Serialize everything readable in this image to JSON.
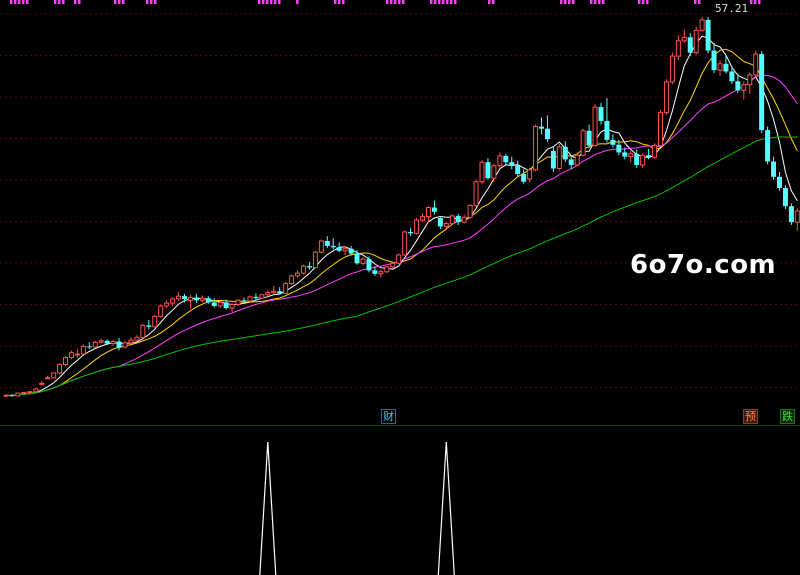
{
  "price_max_label": "57.21",
  "watermark": "6o7o.com",
  "signals": {
    "cai": "财",
    "yu": "预",
    "die": "跌"
  },
  "colors": {
    "bg": "#000000",
    "up": "#ff5050",
    "down": "#54ffff",
    "ma5": "#ffffff",
    "ma10": "#ffd700",
    "ma20": "#ff40ff",
    "ma60": "#00c000",
    "grid": "#600000",
    "marker": "#ff40ff"
  },
  "chart_data": [
    {
      "type": "candlestick",
      "name": "price",
      "y_max_label": 57.21,
      "ylim": [
        2.6,
        58.5
      ],
      "candles": [
        [
          2.9,
          3.1,
          2.7,
          3.0
        ],
        [
          3.0,
          3.2,
          2.8,
          2.9
        ],
        [
          2.9,
          3.4,
          2.8,
          3.3
        ],
        [
          3.3,
          3.5,
          3.2,
          3.4
        ],
        [
          3.4,
          3.6,
          3.3,
          3.5
        ],
        [
          3.5,
          4.0,
          3.4,
          3.9
        ],
        [
          4.6,
          5.0,
          4.4,
          4.7
        ],
        [
          5.4,
          5.8,
          5.3,
          5.5
        ],
        [
          5.5,
          6.3,
          5.4,
          6.2
        ],
        [
          6.2,
          7.6,
          6.0,
          7.4
        ],
        [
          7.4,
          8.6,
          7.2,
          8.4
        ],
        [
          8.4,
          9.4,
          8.2,
          9.1
        ],
        [
          8.9,
          9.6,
          8.4,
          8.9
        ],
        [
          8.9,
          10.3,
          8.8,
          10.0
        ],
        [
          10.0,
          10.6,
          9.6,
          9.9
        ],
        [
          9.9,
          10.8,
          9.8,
          10.6
        ],
        [
          10.6,
          11.1,
          10.4,
          10.8
        ],
        [
          10.8,
          11.0,
          10.2,
          10.4
        ],
        [
          10.4,
          10.9,
          10.1,
          10.7
        ],
        [
          10.7,
          11.2,
          9.4,
          9.8
        ],
        [
          9.9,
          10.8,
          9.7,
          10.5
        ],
        [
          10.5,
          11.3,
          10.3,
          10.9
        ],
        [
          10.9,
          11.6,
          10.8,
          11.3
        ],
        [
          11.3,
          13.2,
          11.1,
          13.0
        ],
        [
          13.0,
          13.8,
          12.4,
          12.8
        ],
        [
          12.8,
          14.5,
          12.7,
          14.3
        ],
        [
          14.3,
          16.0,
          14.1,
          15.8
        ],
        [
          15.8,
          16.6,
          15.5,
          16.2
        ],
        [
          16.2,
          17.0,
          15.8,
          16.8
        ],
        [
          16.8,
          17.8,
          16.5,
          17.2
        ],
        [
          17.2,
          17.5,
          16.3,
          16.8
        ],
        [
          16.6,
          17.4,
          15.4,
          17.0
        ],
        [
          17.0,
          17.5,
          16.2,
          16.6
        ],
        [
          16.6,
          17.3,
          16.3,
          16.9
        ],
        [
          16.9,
          17.2,
          16.1,
          16.3
        ],
        [
          16.3,
          16.9,
          15.6,
          15.8
        ],
        [
          15.8,
          16.5,
          15.5,
          16.3
        ],
        [
          16.3,
          16.7,
          15.3,
          15.5
        ],
        [
          15.5,
          16.2,
          14.9,
          16.0
        ],
        [
          16.0,
          16.8,
          15.8,
          16.6
        ],
        [
          16.6,
          17.0,
          16.1,
          16.5
        ],
        [
          16.5,
          17.3,
          16.4,
          17.1
        ],
        [
          17.1,
          17.6,
          16.6,
          16.9
        ],
        [
          16.9,
          17.5,
          16.8,
          17.4
        ],
        [
          17.4,
          18.1,
          17.2,
          17.7
        ],
        [
          17.7,
          18.7,
          17.5,
          17.9
        ],
        [
          17.9,
          18.5,
          17.4,
          17.6
        ],
        [
          17.6,
          19.2,
          17.5,
          19.0
        ],
        [
          19.0,
          20.3,
          18.8,
          20.1
        ],
        [
          20.1,
          20.9,
          19.8,
          20.5
        ],
        [
          20.5,
          21.7,
          20.3,
          21.5
        ],
        [
          21.5,
          22.1,
          21.0,
          21.3
        ],
        [
          21.3,
          23.7,
          21.2,
          23.5
        ],
        [
          23.5,
          25.3,
          23.3,
          25.1
        ],
        [
          25.1,
          25.8,
          24.1,
          24.4
        ],
        [
          24.4,
          25.5,
          23.9,
          24.2
        ],
        [
          24.2,
          24.9,
          23.5,
          23.7
        ],
        [
          23.7,
          24.3,
          23.1,
          24.0
        ],
        [
          24.0,
          24.4,
          23.0,
          23.3
        ],
        [
          23.3,
          23.8,
          21.7,
          21.9
        ],
        [
          21.9,
          22.8,
          21.6,
          22.5
        ],
        [
          22.5,
          22.9,
          20.6,
          20.9
        ],
        [
          20.9,
          21.5,
          20.1,
          20.4
        ],
        [
          20.4,
          21.0,
          19.9,
          20.7
        ],
        [
          20.7,
          21.5,
          20.5,
          21.4
        ],
        [
          21.4,
          22.1,
          21.2,
          21.9
        ],
        [
          21.9,
          23.3,
          21.8,
          23.1
        ],
        [
          23.1,
          26.6,
          23.0,
          26.4
        ],
        [
          26.4,
          27.0,
          25.8,
          26.2
        ],
        [
          26.2,
          28.4,
          26.0,
          28.1
        ],
        [
          28.1,
          29.1,
          27.8,
          28.6
        ],
        [
          28.6,
          30.1,
          27.8,
          29.9
        ],
        [
          29.9,
          30.9,
          28.9,
          29.3
        ],
        [
          28.4,
          28.7,
          26.8,
          27.2
        ],
        [
          27.2,
          27.8,
          26.6,
          27.6
        ],
        [
          27.6,
          28.9,
          27.4,
          28.7
        ],
        [
          28.7,
          29.0,
          27.4,
          27.8
        ],
        [
          27.8,
          28.9,
          27.6,
          28.5
        ],
        [
          28.5,
          30.4,
          28.3,
          30.2
        ],
        [
          30.2,
          33.9,
          30.0,
          33.6
        ],
        [
          33.6,
          36.7,
          33.3,
          36.4
        ],
        [
          36.4,
          37.0,
          33.9,
          34.1
        ],
        [
          34.1,
          36.2,
          33.6,
          35.9
        ],
        [
          35.9,
          37.8,
          35.6,
          37.3
        ],
        [
          37.3,
          37.6,
          36.0,
          36.4
        ],
        [
          36.4,
          37.2,
          35.4,
          35.9
        ],
        [
          35.9,
          36.6,
          34.4,
          34.7
        ],
        [
          34.7,
          35.4,
          33.3,
          33.6
        ],
        [
          34.0,
          35.6,
          33.5,
          35.3
        ],
        [
          35.3,
          41.8,
          35.1,
          41.5
        ],
        [
          41.5,
          42.8,
          40.4,
          41.2
        ],
        [
          41.2,
          43.1,
          39.3,
          39.7
        ],
        [
          38.0,
          38.7,
          35.0,
          35.5
        ],
        [
          35.5,
          39.0,
          35.2,
          38.6
        ],
        [
          38.6,
          39.4,
          36.4,
          36.8
        ],
        [
          36.8,
          37.4,
          35.4,
          36.0
        ],
        [
          36.0,
          37.8,
          35.8,
          37.4
        ],
        [
          37.4,
          41.2,
          37.2,
          40.9
        ],
        [
          40.9,
          41.8,
          38.4,
          38.8
        ],
        [
          38.8,
          44.7,
          38.6,
          44.3
        ],
        [
          44.3,
          44.9,
          41.8,
          42.3
        ],
        [
          42.3,
          45.6,
          39.2,
          39.6
        ],
        [
          39.6,
          40.4,
          38.5,
          38.9
        ],
        [
          38.9,
          39.6,
          37.4,
          37.8
        ],
        [
          37.8,
          38.5,
          36.8,
          37.2
        ],
        [
          37.2,
          38.0,
          36.4,
          37.6
        ],
        [
          37.6,
          38.2,
          35.6,
          36.0
        ],
        [
          36.0,
          37.7,
          35.6,
          37.4
        ],
        [
          37.4,
          38.3,
          36.8,
          37.1
        ],
        [
          37.1,
          39.1,
          36.9,
          38.8
        ],
        [
          38.8,
          43.9,
          38.6,
          43.5
        ],
        [
          43.5,
          48.3,
          43.2,
          47.9
        ],
        [
          47.9,
          52.1,
          47.6,
          51.6
        ],
        [
          51.6,
          54.6,
          51.0,
          53.8
        ],
        [
          53.8,
          55.4,
          53.5,
          54.3
        ],
        [
          54.3,
          54.9,
          51.6,
          52.1
        ],
        [
          52.1,
          55.8,
          51.8,
          55.3
        ],
        [
          55.3,
          57.2,
          55.1,
          56.8
        ],
        [
          56.8,
          57.21,
          52.0,
          52.4
        ],
        [
          52.4,
          53.5,
          49.2,
          49.6
        ],
        [
          49.6,
          51.0,
          48.8,
          50.5
        ],
        [
          50.5,
          51.6,
          49.1,
          49.4
        ],
        [
          49.4,
          50.2,
          47.6,
          48.0
        ],
        [
          48.0,
          49.1,
          46.3,
          46.7
        ],
        [
          46.7,
          48.0,
          45.4,
          47.5
        ],
        [
          47.5,
          49.3,
          46.2,
          48.9
        ],
        [
          48.9,
          52.4,
          48.6,
          51.9
        ],
        [
          51.9,
          52.3,
          40.6,
          41.0
        ],
        [
          41.0,
          41.5,
          36.1,
          36.5
        ],
        [
          36.5,
          37.2,
          33.9,
          34.3
        ],
        [
          34.3,
          35.0,
          32.3,
          32.7
        ],
        [
          32.7,
          33.1,
          29.7,
          30.1
        ],
        [
          30.1,
          30.5,
          27.4,
          27.8
        ],
        [
          27.8,
          29.8,
          26.6,
          29.4
        ]
      ],
      "moving_averages": [
        {
          "name": "MA5",
          "period": 5,
          "color": "#ffffff"
        },
        {
          "name": "MA10",
          "period": 10,
          "color": "#ffd700"
        },
        {
          "name": "MA20",
          "period": 20,
          "color": "#ff40ff"
        },
        {
          "name": "MA60",
          "period": 60,
          "color": "#00c000"
        }
      ]
    },
    {
      "type": "spike",
      "name": "indicator",
      "ylim": [
        0,
        1
      ],
      "length": 134,
      "spikes": [
        {
          "index": 44,
          "value": 1
        },
        {
          "index": 74,
          "value": 1
        }
      ]
    }
  ]
}
